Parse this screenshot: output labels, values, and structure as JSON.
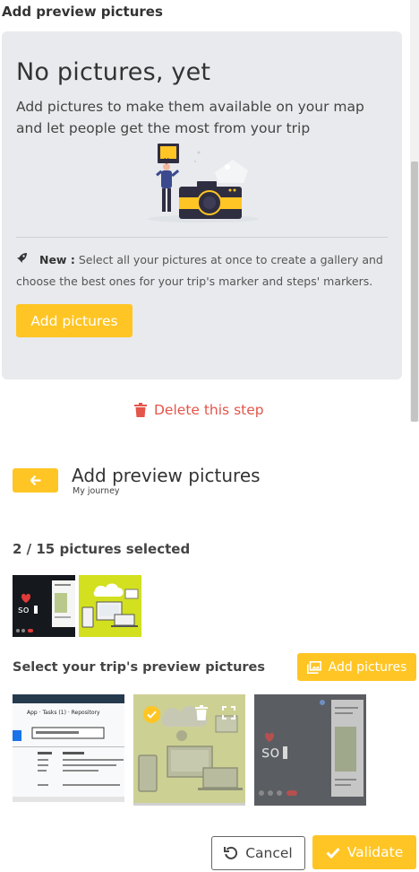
{
  "background_page": {
    "title": "Add preview pictures",
    "empty_state": {
      "heading": "No pictures, yet",
      "text": "Add pictures to make them available on your map and let people get the most from your trip",
      "new_label": "New :",
      "new_text": "Select all your pictures at once to create a gallery and choose the best ones for your trip's marker and steps' markers.",
      "add_button": "Add pictures"
    },
    "delete_label": "Delete this step"
  },
  "modal": {
    "back_icon": "arrow-left-icon",
    "title": "Add preview pictures",
    "subtitle": "My journey",
    "selected_count": "2 / 15 pictures selected",
    "selected_thumbnails": [
      "screenshot-dark-app",
      "devices-illustration"
    ],
    "choose_label": "Select your trip's preview pictures",
    "add_button": "Add pictures",
    "gallery": [
      {
        "name": "screenshot-table-settings",
        "selected": false
      },
      {
        "name": "devices-illustration",
        "selected": true
      },
      {
        "name": "screenshot-dark-app",
        "selected": false
      }
    ],
    "cancel_label": "Cancel",
    "validate_label": "Validate"
  },
  "colors": {
    "accent": "#ffc524",
    "danger": "#e4554a",
    "card_bg": "#e8eaed"
  }
}
